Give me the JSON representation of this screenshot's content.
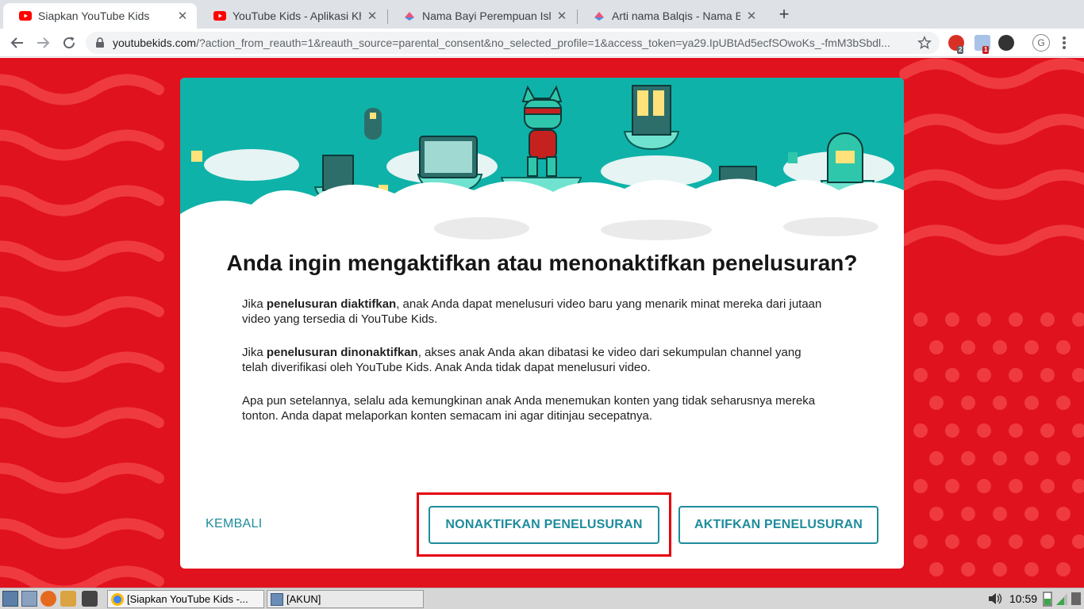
{
  "browser": {
    "tabs": [
      {
        "title": "Siapkan YouTube Kids",
        "active": true
      },
      {
        "title": "YouTube Kids - Aplikasi Kh",
        "active": false
      },
      {
        "title": "Nama Bayi Perempuan Isl",
        "active": false
      },
      {
        "title": "Arti nama Balqis - Nama B",
        "active": false
      }
    ],
    "url_host": "youtubekids.com",
    "url_rest": "/?action_from_reauth=1&reauth_source=parental_consent&no_selected_profile=1&access_token=ya29.IpUBtAd5ecfSOwoKs_-fmM3bSbdl...",
    "extension_badges": [
      "2",
      "1"
    ],
    "profile_initial": "G"
  },
  "dialog": {
    "title": "Anda ingin mengaktifkan atau menonaktifkan penelusuran?",
    "p1_prefix": "Jika ",
    "p1_bold": "penelusuran diaktifkan",
    "p1_rest": ", anak Anda dapat menelusuri video baru yang menarik minat mereka dari jutaan video yang tersedia di YouTube Kids.",
    "p2_prefix": "Jika ",
    "p2_bold": "penelusuran dinonaktifkan",
    "p2_rest": ", akses anak Anda akan dibatasi ke video dari sekumpulan channel yang telah diverifikasi oleh YouTube Kids. Anak Anda tidak dapat menelusuri video.",
    "p3": "Apa pun setelannya, selalu ada kemungkinan anak Anda menemukan konten yang tidak seharusnya mereka tonton. Anda dapat melaporkan konten semacam ini agar ditinjau secepatnya.",
    "back_label": "KEMBALI",
    "disable_label": "NONAKTIFKAN PENELUSURAN",
    "enable_label": "AKTIFKAN PENELUSURAN"
  },
  "taskbar": {
    "tasks": [
      "[Siapkan YouTube Kids -...",
      "[AKUN]"
    ],
    "clock": "10:59"
  },
  "colors": {
    "page_bg": "#e0121d",
    "accent_teal": "#1e8c9c",
    "hero_teal": "#0fb2a8",
    "highlight_red": "#e5000f"
  }
}
